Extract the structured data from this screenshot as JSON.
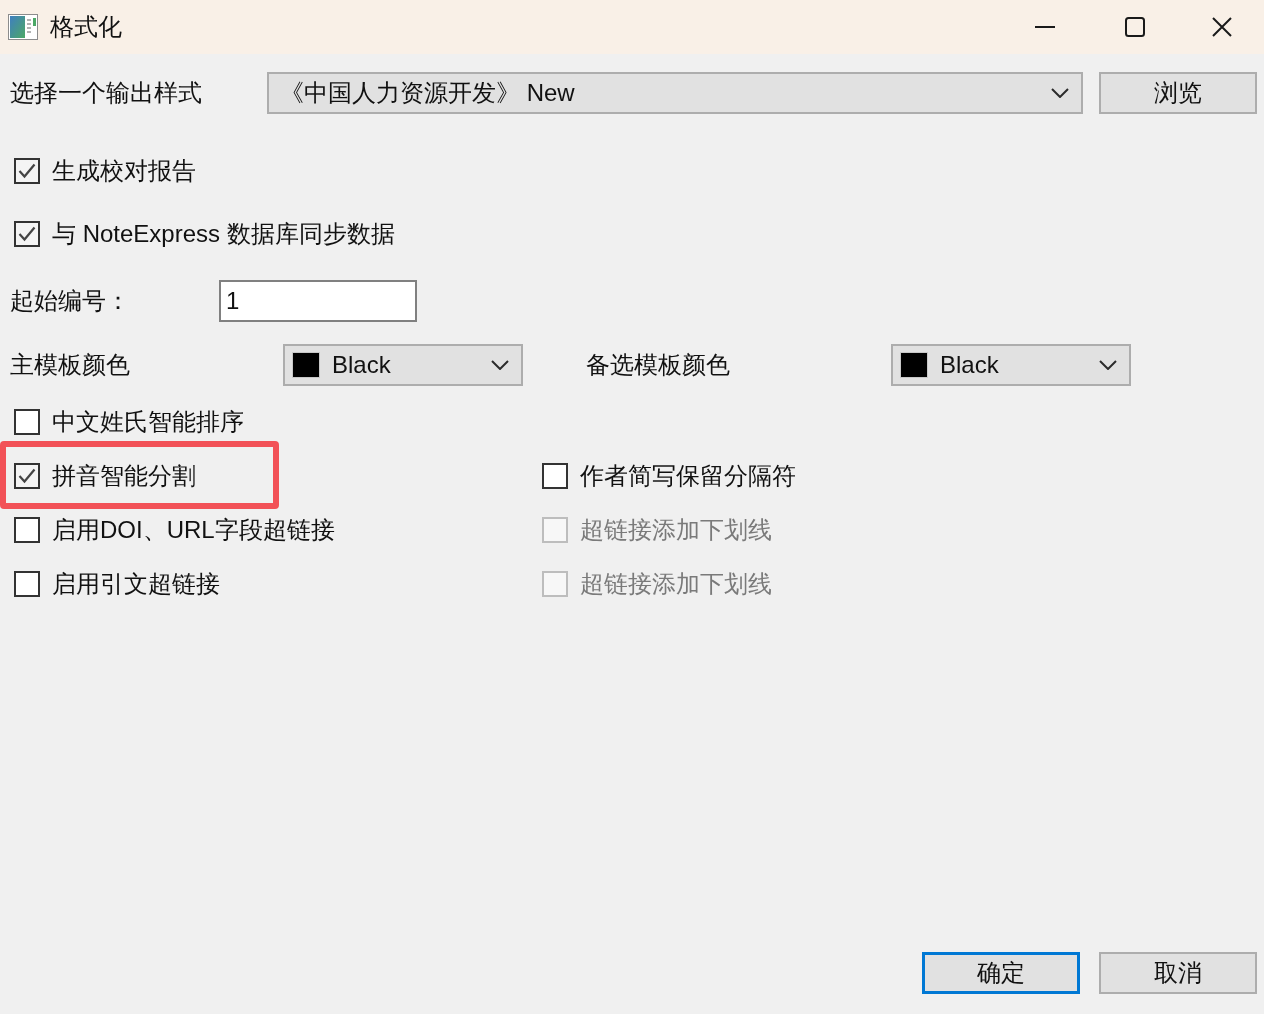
{
  "window": {
    "title": "格式化"
  },
  "output_style": {
    "label": "选择一个输出样式",
    "value": "《中国人力资源开发》 New",
    "browse_button": "浏览"
  },
  "top_options": [
    {
      "label": "生成校对报告",
      "checked": true
    },
    {
      "label": "与 NoteExpress 数据库同步数据",
      "checked": true
    }
  ],
  "start_number": {
    "label": "起始编号：",
    "value": "1"
  },
  "template_colors": [
    {
      "label": "主模板颜色",
      "value": "Black",
      "color": "#000000"
    },
    {
      "label": "备选模板颜色",
      "value": "Black",
      "color": "#000000"
    }
  ],
  "option_rows": [
    {
      "left": {
        "label": "中文姓氏智能排序",
        "checked": false,
        "disabled": false,
        "highlighted": false
      }
    },
    {
      "left": {
        "label": "拼音智能分割",
        "checked": true,
        "disabled": false,
        "highlighted": true
      },
      "right": {
        "label": "作者简写保留分隔符",
        "checked": false,
        "disabled": false,
        "highlighted": false
      }
    },
    {
      "left": {
        "label": "启用DOI、URL字段超链接",
        "checked": false,
        "disabled": false,
        "highlighted": false
      },
      "right": {
        "label": "超链接添加下划线",
        "checked": false,
        "disabled": true,
        "highlighted": false
      }
    },
    {
      "left": {
        "label": "启用引文超链接",
        "checked": false,
        "disabled": false,
        "highlighted": false
      },
      "right": {
        "label": "超链接添加下划线",
        "checked": false,
        "disabled": true,
        "highlighted": false
      }
    }
  ],
  "buttons": [
    {
      "label": "确定",
      "default": true
    },
    {
      "label": "取消",
      "default": false
    }
  ]
}
